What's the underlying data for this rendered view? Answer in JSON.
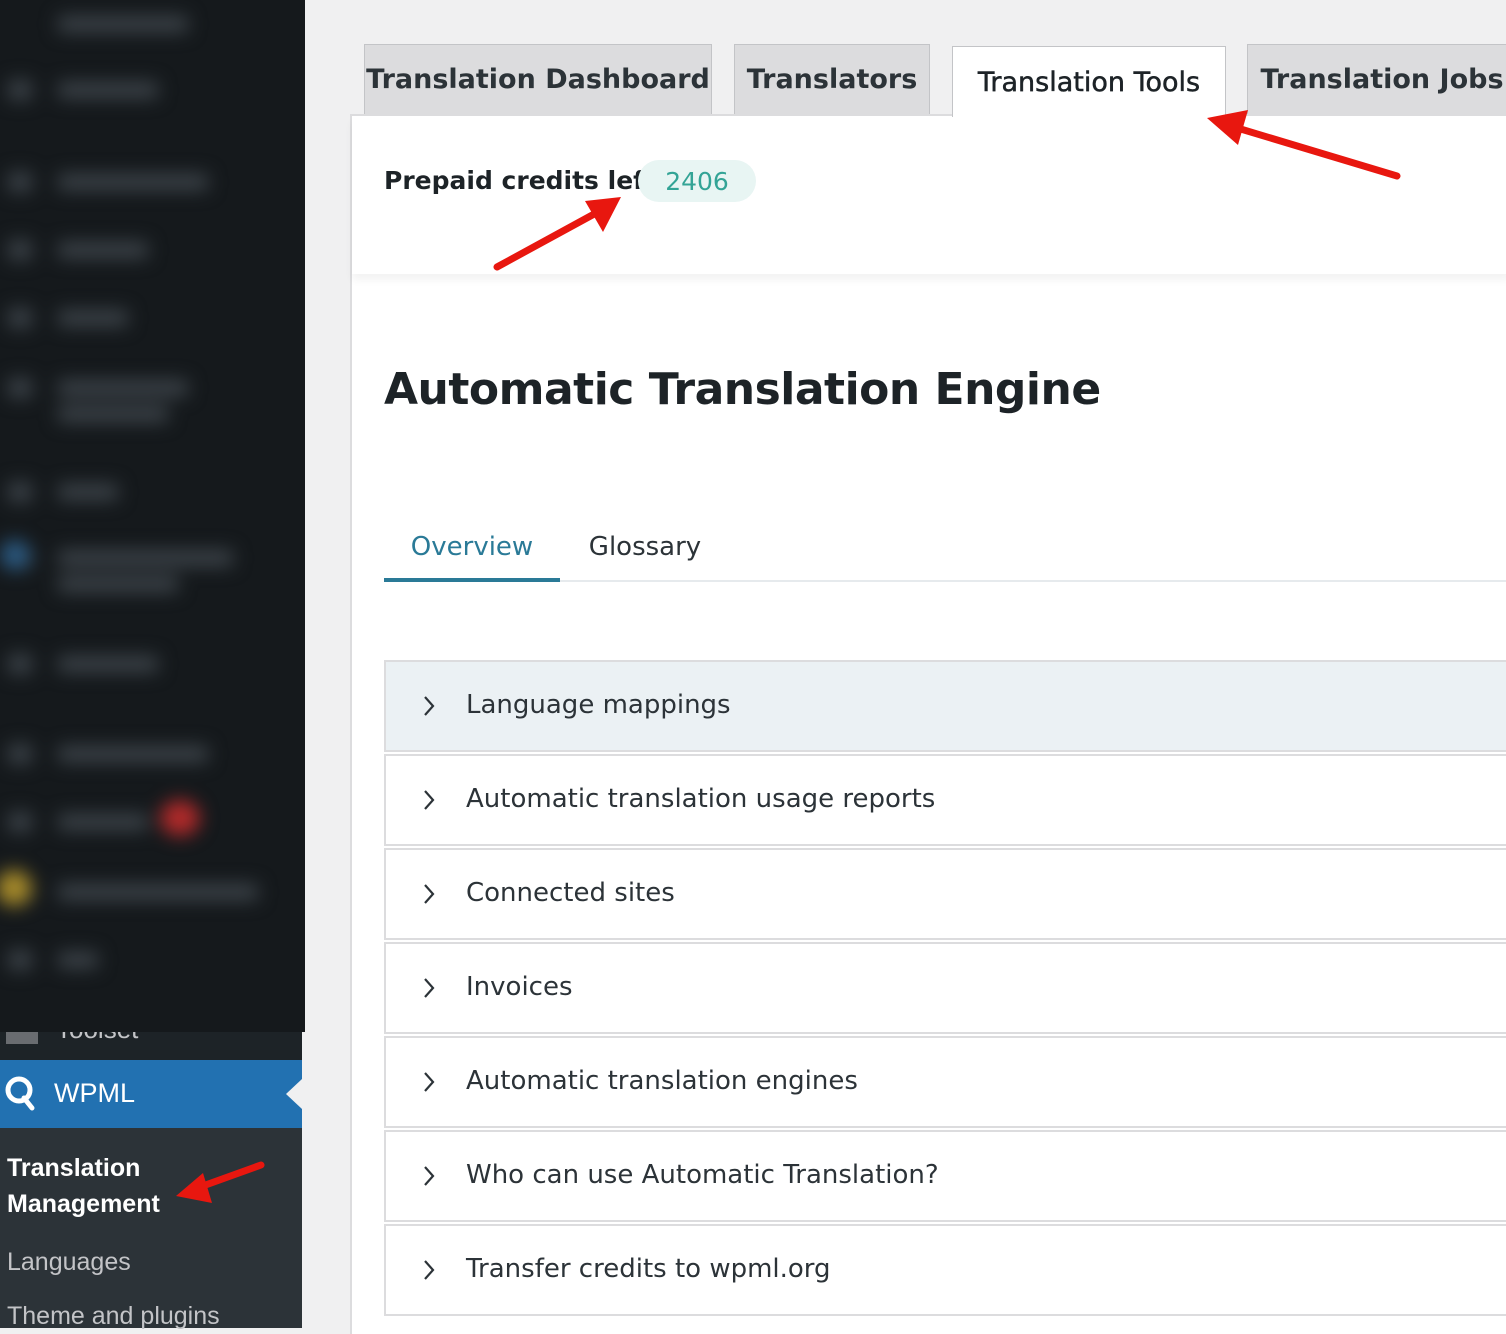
{
  "sidebar": {
    "partial_item_label": "Toolset",
    "active_menu": {
      "label": "WPML"
    },
    "submenu": [
      {
        "label": "Translation Management",
        "current": true
      },
      {
        "label": "Languages",
        "current": false
      },
      {
        "label": "Theme and plugins",
        "current": false
      }
    ]
  },
  "tabs": [
    {
      "label": "Translation Dashboard",
      "active": false
    },
    {
      "label": "Translators",
      "active": false
    },
    {
      "label": "Translation Tools",
      "active": true
    },
    {
      "label": "Translation Jobs",
      "active": false
    }
  ],
  "credits": {
    "label": "Prepaid credits left",
    "value": "2406"
  },
  "engine": {
    "title": "Automatic Translation Engine",
    "subtabs": [
      {
        "label": "Overview",
        "active": true
      },
      {
        "label": "Glossary",
        "active": false
      }
    ],
    "sections": [
      "Language mappings",
      "Automatic translation usage reports",
      "Connected sites",
      "Invoices",
      "Automatic translation engines",
      "Who can use Automatic Translation?",
      "Transfer credits to wpml.org"
    ]
  },
  "colors": {
    "accent": "#2a7a97",
    "wp_admin_blue": "#2271b1",
    "credit_badge_bg": "#e8f5f3",
    "credit_badge_text": "#33a496",
    "annotation_arrow": "#e8170f"
  },
  "icons": {
    "wpml_logo": "wpml-logo-icon",
    "accordion_chevron": "chevron-right-icon",
    "annotation": "red-arrow-icon"
  }
}
